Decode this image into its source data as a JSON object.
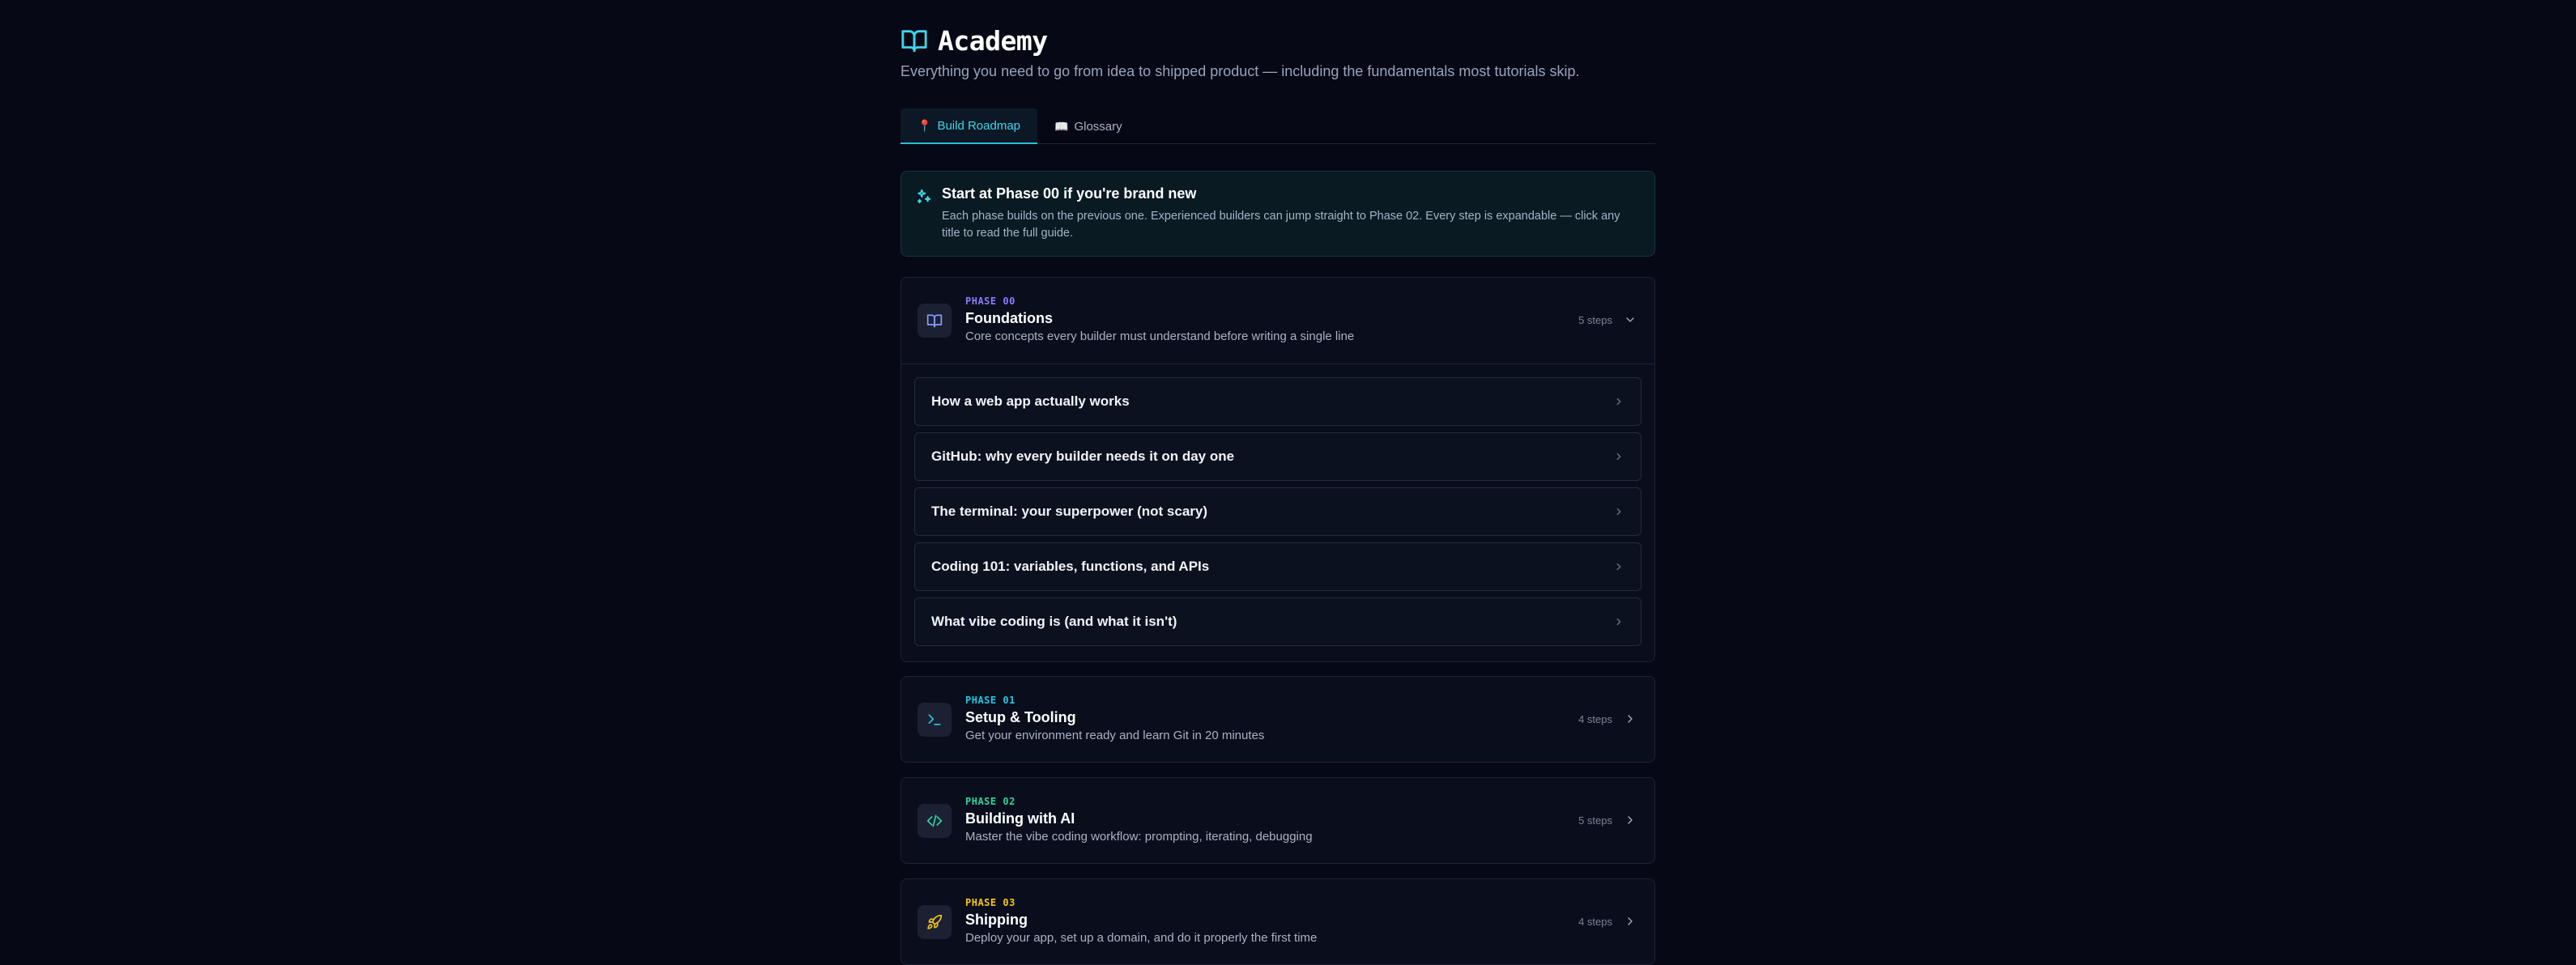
{
  "header": {
    "title": "Academy",
    "subtitle": "Everything you need to go from idea to shipped product — including the fundamentals most tutorials skip."
  },
  "tabs": [
    {
      "icon": "📍",
      "label": "Build Roadmap",
      "active": true
    },
    {
      "icon": "📖",
      "label": "Glossary",
      "active": false
    }
  ],
  "banner": {
    "title": "Start at Phase 00 if you're brand new",
    "text": "Each phase builds on the previous one. Experienced builders can jump straight to Phase 02. Every step is expandable — click any title to read the full guide."
  },
  "phases": [
    {
      "label": "PHASE 00",
      "name": "Foundations",
      "desc": "Core concepts every builder must understand before writing a single line",
      "steps_count": "5 steps",
      "color": "#8b7bff",
      "icon": "book-icon",
      "expanded": true,
      "steps": [
        "How a web app actually works",
        "GitHub: why every builder needs it on day one",
        "The terminal: your superpower (not scary)",
        "Coding 101: variables, functions, and APIs",
        "What vibe coding is (and what it isn't)"
      ]
    },
    {
      "label": "PHASE 01",
      "name": "Setup & Tooling",
      "desc": "Get your environment ready and learn Git in 20 minutes",
      "steps_count": "4 steps",
      "color": "#22c8e0",
      "icon": "terminal-icon",
      "expanded": false
    },
    {
      "label": "PHASE 02",
      "name": "Building with AI",
      "desc": "Master the vibe coding workflow: prompting, iterating, debugging",
      "steps_count": "5 steps",
      "color": "#2fd39a",
      "icon": "code-icon",
      "expanded": false
    },
    {
      "label": "PHASE 03",
      "name": "Shipping",
      "desc": "Deploy your app, set up a domain, and do it properly the first time",
      "steps_count": "4 steps",
      "color": "#f5c518",
      "icon": "rocket-icon",
      "expanded": false
    }
  ],
  "colors": {
    "accent": "#27c0d6",
    "background": "#060816",
    "card": "#0a0e1c"
  }
}
